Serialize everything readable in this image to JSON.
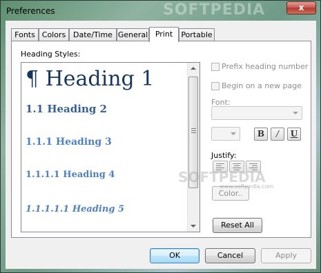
{
  "window": {
    "title": "Preferences",
    "watermark": "SOFTPEDIA",
    "close_label": "x"
  },
  "tabs": [
    {
      "label": "Fonts",
      "active": false
    },
    {
      "label": "Colors",
      "active": false
    },
    {
      "label": "Date/Time",
      "active": false
    },
    {
      "label": "General",
      "active": false
    },
    {
      "label": "Print",
      "active": true
    },
    {
      "label": "Portable",
      "active": false
    }
  ],
  "print": {
    "heading_styles_label": "Heading Styles:",
    "headings": [
      {
        "text": "¶ Heading 1",
        "color": "#17365d"
      },
      {
        "text": "1.1 Heading 2",
        "color": "#365f91"
      },
      {
        "text": "1.1.1 Heading 3",
        "color": "#4f81bd"
      },
      {
        "text": "1.1.1.1 Heading 4",
        "color": "#4f81bd"
      },
      {
        "text": "1.1.1.1.1 Heading 5",
        "color": "#4f81bd"
      }
    ],
    "prefix_heading_number": {
      "label": "Prefix heading number",
      "checked": false,
      "enabled": false
    },
    "begin_new_page": {
      "label": "Begin on a new page",
      "checked": false,
      "enabled": false
    },
    "font_label": "Font:",
    "font_value": "",
    "size_value": "",
    "bold_label": "B",
    "italic_label": "/",
    "underline_label": "U",
    "justify_label": "Justify:",
    "color_button_label": "Color..",
    "reset_all_label": "Reset All",
    "watermark_overlay": "SOFTPEDIA",
    "watermark_url": "www.softpedia.com"
  },
  "dialog_buttons": {
    "ok": "OK",
    "cancel": "Cancel",
    "apply": "Apply"
  }
}
